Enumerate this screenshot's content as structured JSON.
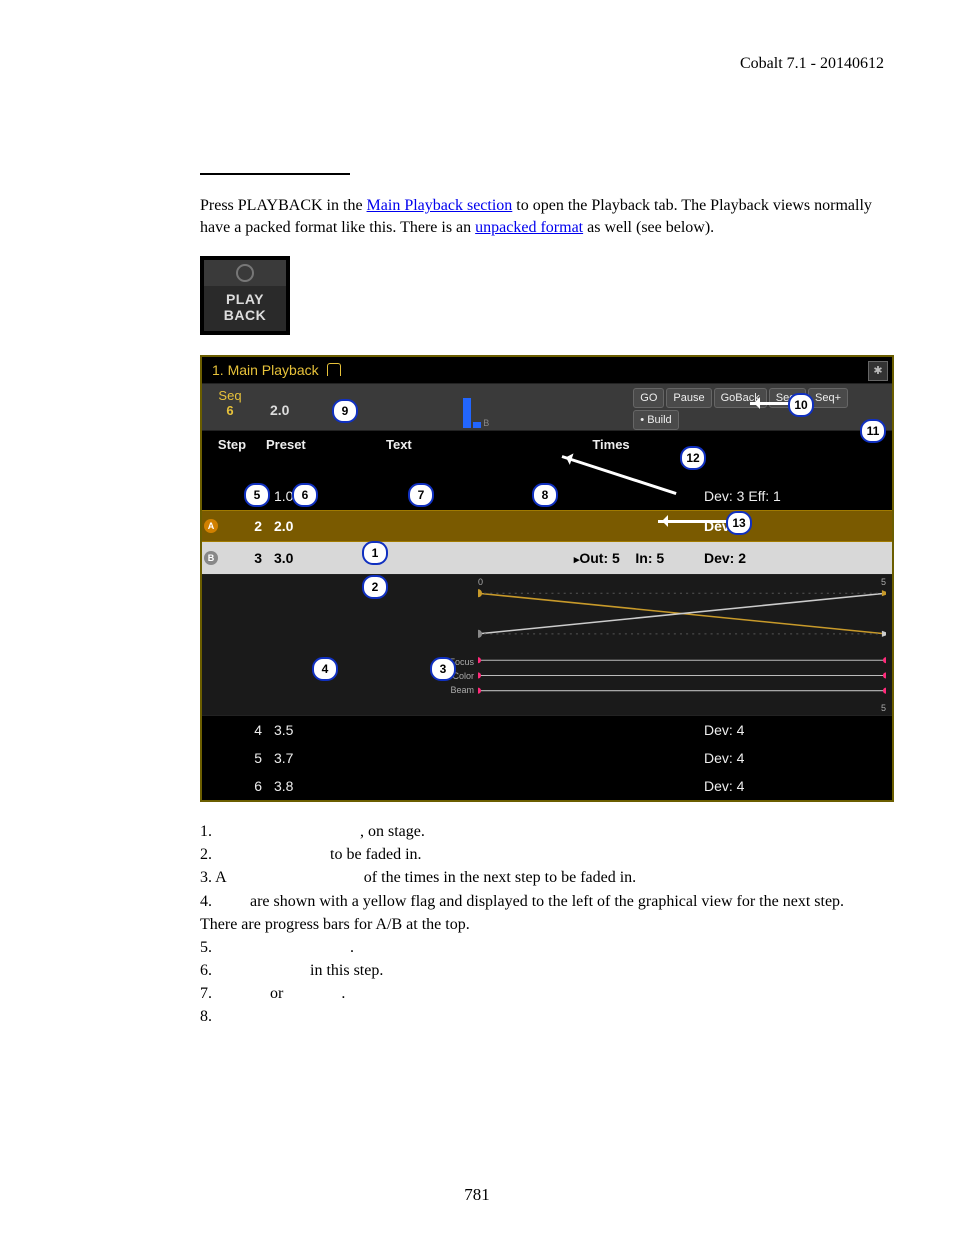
{
  "header": {
    "version": "Cobalt 7.1 - 20140612"
  },
  "intro": {
    "pre": "Press PLAYBACK in the ",
    "link1": "Main Playback section",
    "mid1": " to open the Playback tab. The Playback views normally have a packed format like this. There is an ",
    "link2": "unpacked format",
    "post": " as well (see below)."
  },
  "playback_button": {
    "line1": "PLAY",
    "line2": "BACK"
  },
  "shot": {
    "title": "1. Main Playback",
    "seq_label": "Seq",
    "seq_num": "6",
    "seq_val": "2.0",
    "transport": {
      "go": "GO",
      "pause": "Pause",
      "goback": "GoBack",
      "seq_minus": "Seq-",
      "seq_plus": "Seq+",
      "build": "• Build"
    },
    "columns": {
      "step": "Step",
      "preset": "Preset",
      "text": "Text",
      "times": "Times"
    },
    "rows": [
      {
        "step": "1",
        "preset": "1.0",
        "times": "",
        "dev": "Dev: 3   Eff: 1"
      },
      {
        "step": "2",
        "preset": "2.0",
        "times": "",
        "dev": "Dev: 2",
        "hilite": "A"
      },
      {
        "step": "3",
        "preset": "3.0",
        "times_out": "Out: 5",
        "times_in": "In: 5",
        "dev": "Dev: 2",
        "hilite": "B"
      },
      {
        "step": "4",
        "preset": "3.5",
        "times": "",
        "dev": "Dev: 4"
      },
      {
        "step": "5",
        "preset": "3.7",
        "times": "",
        "dev": "Dev: 4"
      },
      {
        "step": "6",
        "preset": "3.8",
        "times": "",
        "dev": "Dev: 4"
      }
    ],
    "graph": {
      "tick0": "0",
      "tick5a": "5",
      "tick5b": "5",
      "labels": [
        "Focus",
        "Color",
        "Beam"
      ]
    }
  },
  "callouts": {
    "c1": "1",
    "c2": "2",
    "c3": "3",
    "c4": "4",
    "c5": "5",
    "c6": "6",
    "c7": "7",
    "c8": "8",
    "c9": "9",
    "c10": "10",
    "c11": "11",
    "c12": "12",
    "c13": "13"
  },
  "legend": {
    "l1a": "1. ",
    "l1b": ", on stage.",
    "l2a": "2. ",
    "l2b": " to be faded in.",
    "l3a": "3. A ",
    "l3b": " of the times in the next step to be faded in.",
    "l4a": "4. ",
    "l4b": " are shown with a yellow flag and displayed to the left of the graphical view for the next step. There are progress bars for A/B at the top.",
    "l5a": "5. ",
    "l5b": ".",
    "l6a": "6. ",
    "l6b": " in this step.",
    "l7a": "7. ",
    "l7b": " or ",
    "l7c": ".",
    "l8a": "8. "
  },
  "page_number": "781"
}
